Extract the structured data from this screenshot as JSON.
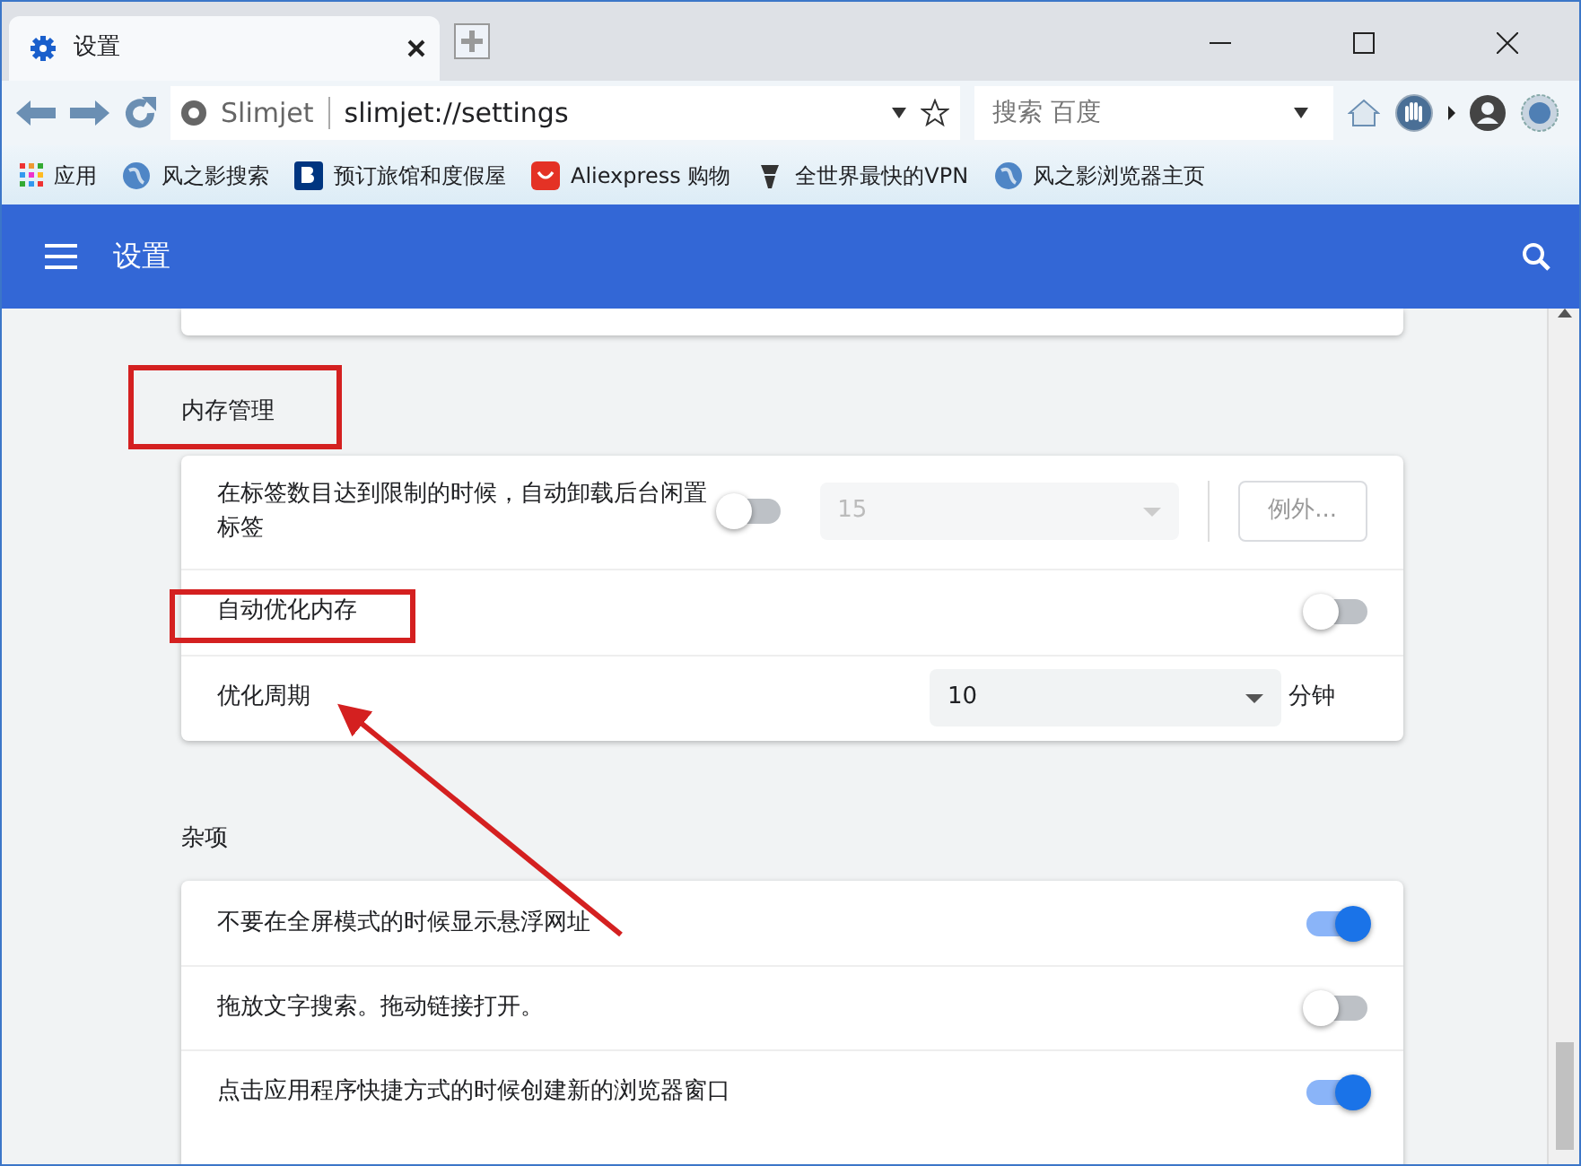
{
  "tab": {
    "title": "设置"
  },
  "toolbar": {
    "site_name": "Slimjet",
    "url": "slimjet://settings",
    "search_placeholder": "搜索 百度"
  },
  "bookmarks": [
    {
      "kind": "apps",
      "label": "应用"
    },
    {
      "kind": "globe",
      "label": "风之影搜索"
    },
    {
      "kind": "booking",
      "label": "预订旅馆和度假屋"
    },
    {
      "kind": "shop",
      "label": "Aliexpress 购物"
    },
    {
      "kind": "vpn",
      "label": "全世界最快的VPN"
    },
    {
      "kind": "globe",
      "label": "风之影浏览器主页"
    }
  ],
  "header": {
    "title": "设置"
  },
  "sections": [
    {
      "title": "内存管理",
      "rows": [
        {
          "kind": "limit",
          "label": "在标签数目达到限制的时候，自动卸载后台闲置标签",
          "on": false,
          "select": {
            "value": "15",
            "disabled": true
          },
          "button": {
            "label": "例外...",
            "disabled": true
          }
        },
        {
          "kind": "toggle",
          "label": "自动优化内存",
          "on": false
        },
        {
          "kind": "select",
          "label": "优化周期",
          "select": {
            "value": "10",
            "disabled": false
          },
          "unit": "分钟"
        }
      ]
    },
    {
      "title": "杂项",
      "rows": [
        {
          "kind": "toggle",
          "label": "不要在全屏模式的时候显示悬浮网址",
          "on": true
        },
        {
          "kind": "toggle",
          "label": "拖放文字搜索。拖动链接打开。",
          "on": false
        },
        {
          "kind": "toggle",
          "label": "点击应用程序快捷方式的时候创建新的浏览器窗口",
          "on": true
        }
      ]
    }
  ]
}
